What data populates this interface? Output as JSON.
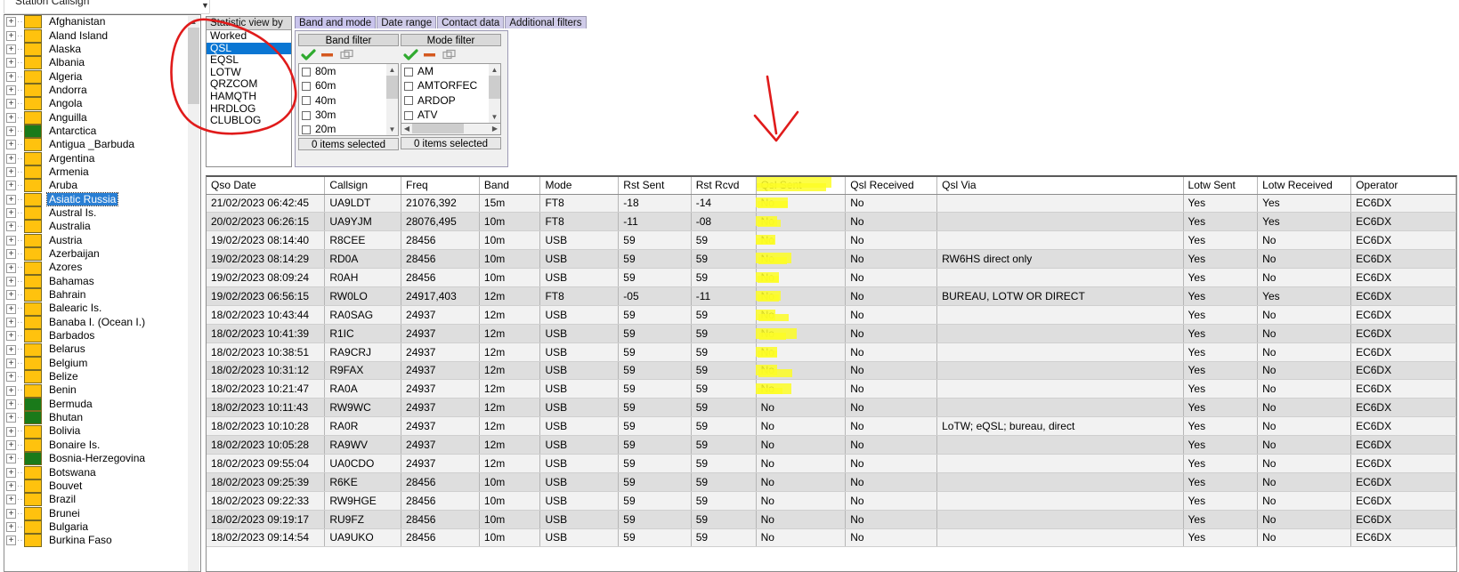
{
  "station": {
    "label": "Station Callsign",
    "value": "",
    "caret_icon": "chevron-down-icon"
  },
  "tree": {
    "scroll_up_icon": "chevron-up-icon",
    "scroll_down_icon": "chevron-down-icon",
    "expand_icon": "plus-box-icon",
    "items": [
      {
        "label": "Afghanistan",
        "color": "#ffc20e",
        "selected": false
      },
      {
        "label": "Aland Island",
        "color": "#ffc20e",
        "selected": false
      },
      {
        "label": "Alaska",
        "color": "#ffc20e",
        "selected": false
      },
      {
        "label": "Albania",
        "color": "#ffc20e",
        "selected": false
      },
      {
        "label": "Algeria",
        "color": "#ffc20e",
        "selected": false
      },
      {
        "label": "Andorra",
        "color": "#ffc20e",
        "selected": false
      },
      {
        "label": "Angola",
        "color": "#ffc20e",
        "selected": false
      },
      {
        "label": "Anguilla",
        "color": "#ffc20e",
        "selected": false
      },
      {
        "label": "Antarctica",
        "color": "#1a7a1a",
        "selected": false
      },
      {
        "label": "Antigua _Barbuda",
        "color": "#ffc20e",
        "selected": false
      },
      {
        "label": "Argentina",
        "color": "#ffc20e",
        "selected": false
      },
      {
        "label": "Armenia",
        "color": "#ffc20e",
        "selected": false
      },
      {
        "label": "Aruba",
        "color": "#ffc20e",
        "selected": false
      },
      {
        "label": "Asiatic Russia",
        "color": "#ffc20e",
        "selected": true
      },
      {
        "label": "Austral Is.",
        "color": "#ffc20e",
        "selected": false
      },
      {
        "label": "Australia",
        "color": "#ffc20e",
        "selected": false
      },
      {
        "label": "Austria",
        "color": "#ffc20e",
        "selected": false
      },
      {
        "label": "Azerbaijan",
        "color": "#ffc20e",
        "selected": false
      },
      {
        "label": "Azores",
        "color": "#ffc20e",
        "selected": false
      },
      {
        "label": "Bahamas",
        "color": "#ffc20e",
        "selected": false
      },
      {
        "label": "Bahrain",
        "color": "#ffc20e",
        "selected": false
      },
      {
        "label": "Balearic Is.",
        "color": "#ffc20e",
        "selected": false
      },
      {
        "label": "Banaba I. (Ocean I.)",
        "color": "#ffc20e",
        "selected": false
      },
      {
        "label": "Barbados",
        "color": "#ffc20e",
        "selected": false
      },
      {
        "label": "Belarus",
        "color": "#ffc20e",
        "selected": false
      },
      {
        "label": "Belgium",
        "color": "#ffc20e",
        "selected": false
      },
      {
        "label": "Belize",
        "color": "#ffc20e",
        "selected": false
      },
      {
        "label": "Benin",
        "color": "#ffc20e",
        "selected": false
      },
      {
        "label": "Bermuda",
        "color": "#1a7a1a",
        "selected": false
      },
      {
        "label": "Bhutan",
        "color": "#1a7a1a",
        "selected": false
      },
      {
        "label": "Bolivia",
        "color": "#ffc20e",
        "selected": false
      },
      {
        "label": "Bonaire Is.",
        "color": "#ffc20e",
        "selected": false
      },
      {
        "label": "Bosnia-Herzegovina",
        "color": "#1a7a1a",
        "selected": false
      },
      {
        "label": "Botswana",
        "color": "#ffc20e",
        "selected": false
      },
      {
        "label": "Bouvet",
        "color": "#ffc20e",
        "selected": false
      },
      {
        "label": "Brazil",
        "color": "#ffc20e",
        "selected": false
      },
      {
        "label": "Brunei",
        "color": "#ffc20e",
        "selected": false
      },
      {
        "label": "Bulgaria",
        "color": "#ffc20e",
        "selected": false
      },
      {
        "label": "Burkina Faso",
        "color": "#ffc20e",
        "selected": false
      }
    ]
  },
  "statistic_view": {
    "header": "Statistic view by",
    "selected": "QSL",
    "items": [
      "Worked",
      "QSL",
      "EQSL",
      "LOTW",
      "QRZCOM",
      "HAMQTH",
      "HRDLOG",
      "CLUBLOG"
    ]
  },
  "filter_tabs": {
    "active": "Band and mode",
    "tabs": [
      "Band and mode",
      "Date range",
      "Contact data",
      "Additional filters"
    ]
  },
  "band_filter": {
    "title": "Band filter",
    "tools": [
      "check-all-icon",
      "uncheck-all-icon",
      "invert-selection-icon"
    ],
    "items": [
      "80m",
      "60m",
      "40m",
      "30m",
      "20m"
    ],
    "status": "0 items selected"
  },
  "mode_filter": {
    "title": "Mode filter",
    "tools": [
      "check-all-icon",
      "uncheck-all-icon",
      "invert-selection-icon"
    ],
    "items": [
      "AM",
      "AMTORFEC",
      "ARDOP",
      "ATV"
    ],
    "status": "0 items selected"
  },
  "grid": {
    "columns": [
      "Qso Date",
      "Callsign",
      "Freq",
      "Band",
      "Mode",
      "Rst Sent",
      "Rst Rcvd",
      "Qsl Sent",
      "Qsl Received",
      "Qsl Via",
      "Lotw Sent",
      "Lotw Received",
      "Operator"
    ],
    "highlighted_column": "Qsl Sent",
    "rows": [
      [
        "21/02/2023 06:42:45",
        "UA9LDT",
        "21076,392",
        "15m",
        "FT8",
        "-18",
        "-14",
        "No",
        "No",
        "",
        "Yes",
        "Yes",
        "EC6DX"
      ],
      [
        "20/02/2023 06:26:15",
        "UA9YJM",
        "28076,495",
        "10m",
        "FT8",
        "-11",
        "-08",
        "No",
        "No",
        "",
        "Yes",
        "Yes",
        "EC6DX"
      ],
      [
        "19/02/2023 08:14:40",
        "R8CEE",
        "28456",
        "10m",
        "USB",
        "59",
        "59",
        "No",
        "No",
        "",
        "Yes",
        "No",
        "EC6DX"
      ],
      [
        "19/02/2023 08:14:29",
        "RD0A",
        "28456",
        "10m",
        "USB",
        "59",
        "59",
        "No",
        "No",
        "RW6HS direct only",
        "Yes",
        "No",
        "EC6DX"
      ],
      [
        "19/02/2023 08:09:24",
        "R0AH",
        "28456",
        "10m",
        "USB",
        "59",
        "59",
        "No",
        "No",
        "",
        "Yes",
        "No",
        "EC6DX"
      ],
      [
        "19/02/2023 06:56:15",
        "RW0LO",
        "24917,403",
        "12m",
        "FT8",
        "-05",
        "-11",
        "No",
        "No",
        "BUREAU, LOTW OR DIRECT",
        "Yes",
        "Yes",
        "EC6DX"
      ],
      [
        "18/02/2023 10:43:44",
        "RA0SAG",
        "24937",
        "12m",
        "USB",
        "59",
        "59",
        "No",
        "No",
        "",
        "Yes",
        "No",
        "EC6DX"
      ],
      [
        "18/02/2023 10:41:39",
        "R1IC",
        "24937",
        "12m",
        "USB",
        "59",
        "59",
        "No",
        "No",
        "",
        "Yes",
        "No",
        "EC6DX"
      ],
      [
        "18/02/2023 10:38:51",
        "RA9CRJ",
        "24937",
        "12m",
        "USB",
        "59",
        "59",
        "No",
        "No",
        "",
        "Yes",
        "No",
        "EC6DX"
      ],
      [
        "18/02/2023 10:31:12",
        "R9FAX",
        "24937",
        "12m",
        "USB",
        "59",
        "59",
        "No",
        "No",
        "",
        "Yes",
        "No",
        "EC6DX"
      ],
      [
        "18/02/2023 10:21:47",
        "RA0A",
        "24937",
        "12m",
        "USB",
        "59",
        "59",
        "No",
        "No",
        "",
        "Yes",
        "No",
        "EC6DX"
      ],
      [
        "18/02/2023 10:11:43",
        "RW9WC",
        "24937",
        "12m",
        "USB",
        "59",
        "59",
        "No",
        "No",
        "",
        "Yes",
        "No",
        "EC6DX"
      ],
      [
        "18/02/2023 10:10:28",
        "RA0R",
        "24937",
        "12m",
        "USB",
        "59",
        "59",
        "No",
        "No",
        "LoTW; eQSL; bureau, direct",
        "Yes",
        "No",
        "EC6DX"
      ],
      [
        "18/02/2023 10:05:28",
        "RA9WV",
        "24937",
        "12m",
        "USB",
        "59",
        "59",
        "No",
        "No",
        "",
        "Yes",
        "No",
        "EC6DX"
      ],
      [
        "18/02/2023 09:55:04",
        "UA0CDO",
        "24937",
        "12m",
        "USB",
        "59",
        "59",
        "No",
        "No",
        "",
        "Yes",
        "No",
        "EC6DX"
      ],
      [
        "18/02/2023 09:25:39",
        "R6KE",
        "28456",
        "10m",
        "USB",
        "59",
        "59",
        "No",
        "No",
        "",
        "Yes",
        "No",
        "EC6DX"
      ],
      [
        "18/02/2023 09:22:33",
        "RW9HGE",
        "28456",
        "10m",
        "USB",
        "59",
        "59",
        "No",
        "No",
        "",
        "Yes",
        "No",
        "EC6DX"
      ],
      [
        "18/02/2023 09:19:17",
        "RU9FZ",
        "28456",
        "10m",
        "USB",
        "59",
        "59",
        "No",
        "No",
        "",
        "Yes",
        "No",
        "EC6DX"
      ],
      [
        "18/02/2023 09:14:54",
        "UA9UKO",
        "28456",
        "10m",
        "USB",
        "59",
        "59",
        "No",
        "No",
        "",
        "Yes",
        "No",
        "EC6DX"
      ]
    ]
  },
  "annotations": {
    "circle_target": "Statistic view by list",
    "arrow_color": "#e01b1b",
    "highlight_color": "#fdfd26"
  }
}
